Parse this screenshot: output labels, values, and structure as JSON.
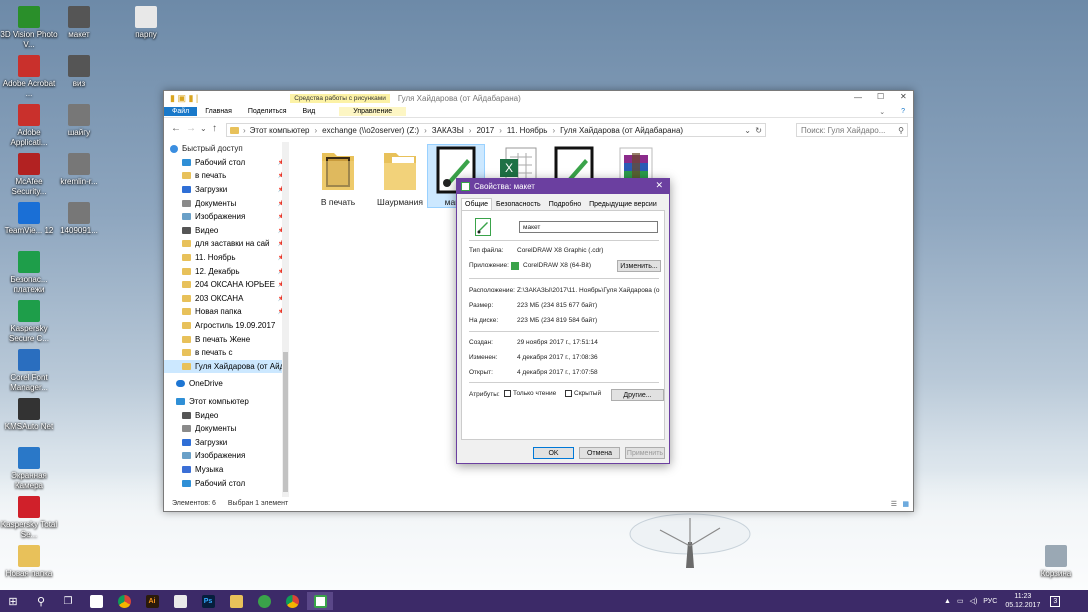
{
  "desktop": {
    "icons": [
      {
        "label": "3D Vision Photo V...",
        "icon": "3d-vision-icon",
        "color": "#2a8f2a"
      },
      {
        "label": "макет",
        "icon": "coreldraw-file-icon",
        "color": "#555555"
      },
      {
        "label": "парпу",
        "icon": "image-file-icon",
        "color": "#e8e8e8"
      },
      {
        "label": "Adobe Acrobat ...",
        "icon": "acrobat-icon",
        "color": "#c9302c"
      },
      {
        "label": "виз",
        "icon": "coreldraw-file-icon",
        "color": "#555555"
      },
      {
        "label": "Adobe Applicati...",
        "icon": "adobe-app-manager-icon",
        "color": "#c9302c"
      },
      {
        "label": "шайгу",
        "icon": "image-file-icon",
        "color": "#777777"
      },
      {
        "label": "McAfee Security...",
        "icon": "mcafee-icon",
        "color": "#b22222"
      },
      {
        "label": "kremlin-r...",
        "icon": "image-file-icon",
        "color": "#777777"
      },
      {
        "label": "TeamVie... 12",
        "icon": "teamviewer-icon",
        "color": "#1a6fd6"
      },
      {
        "label": "1409091...",
        "icon": "image-file-icon",
        "color": "#777777"
      },
      {
        "label": "Безопас... платежи",
        "icon": "safe-money-icon",
        "color": "#1e9e4a"
      },
      {
        "label": "Kaspersky Secure C...",
        "icon": "kaspersky-secure-icon",
        "color": "#1e9e4a"
      },
      {
        "label": "Corel Font Manager...",
        "icon": "corel-font-icon",
        "color": "#2a6ebf"
      },
      {
        "label": "KMSAuto Net",
        "icon": "kmsauto-icon",
        "color": "#333333"
      },
      {
        "label": "Экранная Камера",
        "icon": "screen-camera-icon",
        "color": "#2a78c8"
      },
      {
        "label": "Kaspersky Total Se...",
        "icon": "kaspersky-total-icon",
        "color": "#d0202a"
      },
      {
        "label": "Новая папка",
        "icon": "folder-icon",
        "color": "#e8c15a"
      },
      {
        "label": "Корзина",
        "icon": "recycle-bin-icon",
        "color": "#9aa8b4"
      }
    ]
  },
  "explorer": {
    "title": "Гуля Хайдарова (от Айдабарана)",
    "contextual_tab_group": "Средства работы с рисунками",
    "ribbon_tabs": [
      "Файл",
      "Главная",
      "Поделиться",
      "Вид",
      "Управление"
    ],
    "address_path": [
      "Этот компьютер",
      "exchange (\\\\o2oserver) (Z:)",
      "ЗАКАЗЫ",
      "2017",
      "11. Ноябрь",
      "Гуля Хайдарова (от Айдабарана)"
    ],
    "search_placeholder": "Поиск: Гуля Хайдаро...",
    "nav": {
      "quick_access": "Быстрый доступ",
      "quick_items": [
        {
          "label": "Рабочий стол",
          "pinned": true,
          "icon": "desktop-folder-icon"
        },
        {
          "label": "в печать",
          "pinned": true,
          "icon": "folder-icon"
        },
        {
          "label": "Загрузки",
          "pinned": true,
          "icon": "downloads-icon"
        },
        {
          "label": "Документы",
          "pinned": true,
          "icon": "documents-icon"
        },
        {
          "label": "Изображения",
          "pinned": true,
          "icon": "pictures-icon"
        },
        {
          "label": "Видео",
          "pinned": true,
          "icon": "video-icon"
        },
        {
          "label": "для заставки на сай",
          "pinned": true,
          "icon": "folder-icon"
        },
        {
          "label": "11. Ноябрь",
          "pinned": true,
          "icon": "folder-icon"
        },
        {
          "label": "12. Декабрь",
          "pinned": true,
          "icon": "folder-icon"
        },
        {
          "label": "204 ОКСАНА ЮРЬЕЕ",
          "pinned": true,
          "icon": "folder-icon"
        },
        {
          "label": "203 ОКСАНА",
          "pinned": true,
          "icon": "folder-icon"
        },
        {
          "label": "Новая папка",
          "pinned": true,
          "icon": "folder-icon"
        },
        {
          "label": "Агростиль 19.09.2017",
          "pinned": false,
          "icon": "folder-icon"
        },
        {
          "label": "В печать Жене",
          "pinned": false,
          "icon": "folder-icon"
        },
        {
          "label": "в печать с",
          "pinned": false,
          "icon": "folder-icon"
        },
        {
          "label": "Гуля Хайдарова (от Айда",
          "pinned": false,
          "icon": "folder-icon",
          "selected": true
        }
      ],
      "onedrive": "OneDrive",
      "this_pc": "Этот компьютер",
      "pc_items": [
        {
          "label": "Видео",
          "icon": "video-icon"
        },
        {
          "label": "Документы",
          "icon": "documents-icon"
        },
        {
          "label": "Загрузки",
          "icon": "downloads-icon"
        },
        {
          "label": "Изображения",
          "icon": "pictures-icon"
        },
        {
          "label": "Музыка",
          "icon": "music-icon"
        },
        {
          "label": "Рабочий стол",
          "icon": "desktop-folder-icon"
        }
      ]
    },
    "files": [
      {
        "label": "В печать",
        "icon": "folder-with-images-icon"
      },
      {
        "label": "Шаурмания",
        "icon": "folder-icon"
      },
      {
        "label": "макет",
        "icon": "coreldraw-file-icon"
      },
      {
        "label": "",
        "icon": "excel-file-icon"
      },
      {
        "label": "",
        "icon": "coreldraw-file-icon"
      },
      {
        "label": "",
        "icon": "winrar-archive-icon"
      }
    ],
    "status_items": "Элементов: 6",
    "status_selected": "Выбран 1 элемент"
  },
  "dialog": {
    "title": "Свойства: макет",
    "tabs": [
      "Общие",
      "Безопасность",
      "Подробно",
      "Предыдущие версии"
    ],
    "filename": "макет",
    "file_type_label": "Тип файла:",
    "file_type": "CorelDRAW X8 Graphic (.cdr)",
    "app_label": "Приложение:",
    "app": "CorelDRAW X8 (64-Bit)",
    "change_btn": "Изменить...",
    "location_label": "Расположение:",
    "location": "Z:\\ЗАКАЗЫ\\2017\\11. Ноябрь\\Гуля Хайдарова (о",
    "size_label": "Размер:",
    "size": "223 МБ (234 815 677 байт)",
    "disk_label": "На диске:",
    "disk": "223 МБ (234 819 584 байт)",
    "created_label": "Создан:",
    "created": "29 ноября 2017 г., 17:51:14",
    "modified_label": "Изменен:",
    "modified": "4 декабря 2017 г., 17:08:36",
    "opened_label": "Открыт:",
    "opened": "4 декабря 2017 г., 17:07:58",
    "attrs_label": "Атрибуты:",
    "readonly": "Только чтение",
    "hidden": "Скрытый",
    "other_btn": "Другие...",
    "ok": "OK",
    "cancel": "Отмена",
    "apply": "Применить"
  },
  "taskbar": {
    "lang": "РУС",
    "time": "11:23",
    "date": "05.12.2017",
    "notifications": "3",
    "accent": "#3c2a68"
  }
}
